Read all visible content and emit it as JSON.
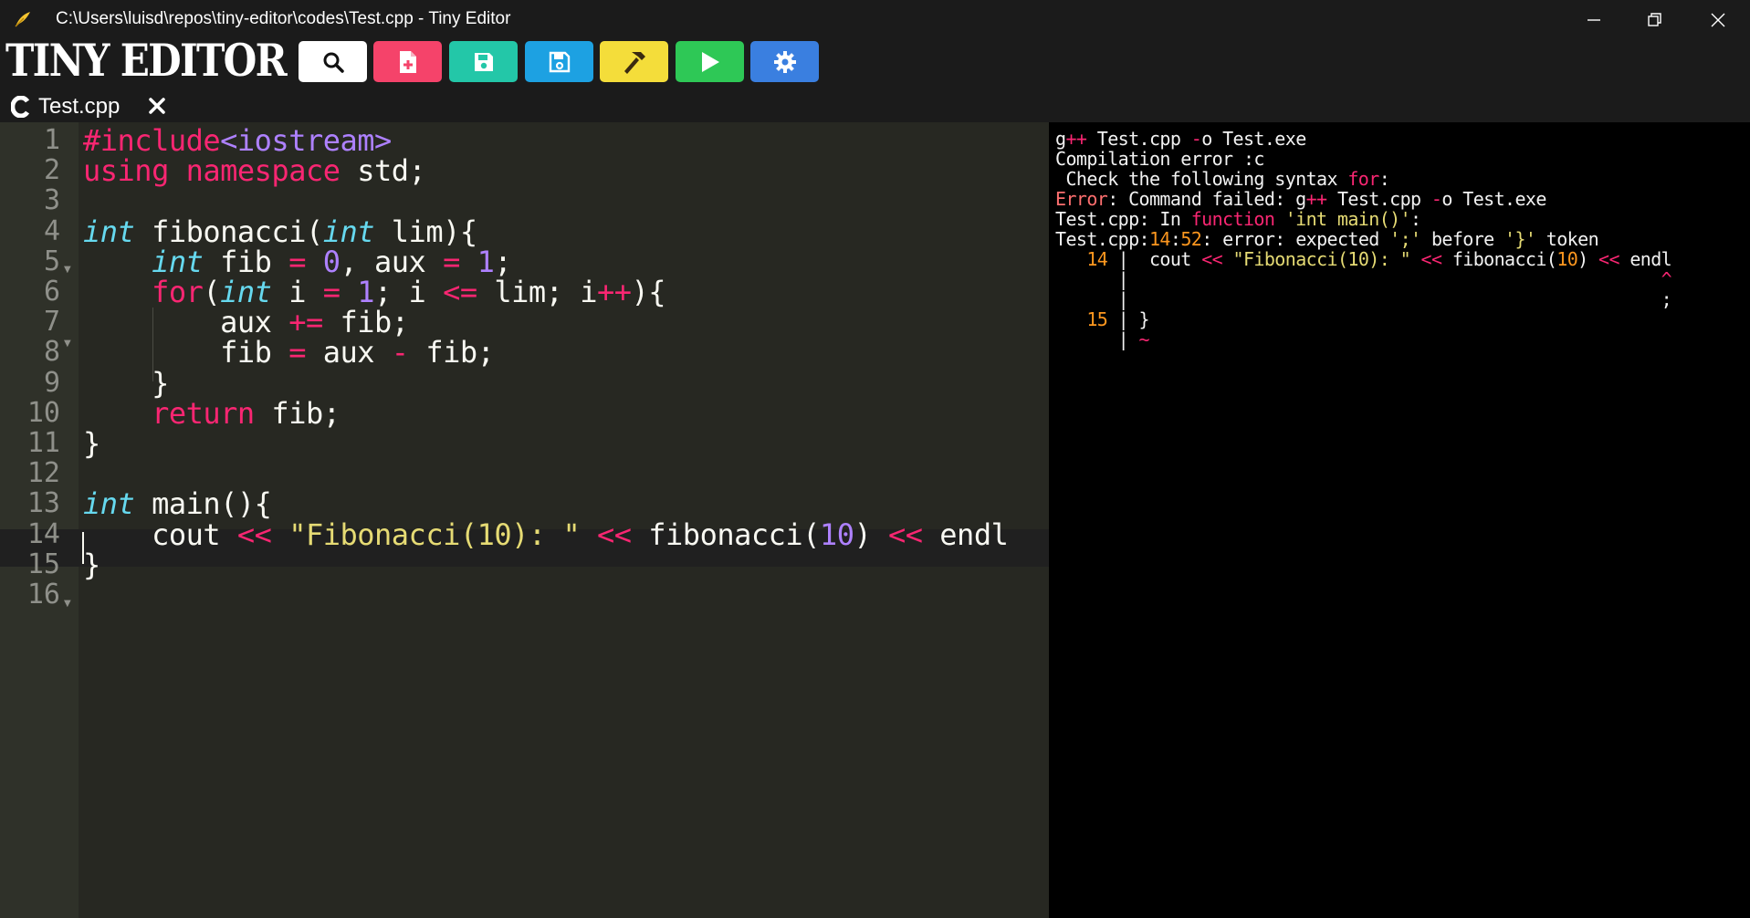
{
  "window": {
    "title": "C:\\Users\\luisd\\repos\\tiny-editor\\codes\\Test.cpp - Tiny Editor",
    "icon": "feather-icon"
  },
  "header": {
    "logo_text": "TINY EDITOR",
    "toolbar": [
      {
        "name": "search-button",
        "icon": "search-icon",
        "color": "#ffffff"
      },
      {
        "name": "new-file-button",
        "icon": "new-file-icon",
        "color": "#f5436a"
      },
      {
        "name": "save-button",
        "icon": "save-icon",
        "color": "#23c7a8"
      },
      {
        "name": "save-as-button",
        "icon": "save-as-icon",
        "color": "#1da1e2"
      },
      {
        "name": "build-button",
        "icon": "hammer-icon",
        "color": "#f4dd3a"
      },
      {
        "name": "run-button",
        "icon": "play-icon",
        "color": "#2ec856"
      },
      {
        "name": "settings-button",
        "icon": "gear-icon",
        "color": "#3a7fe0"
      }
    ]
  },
  "tab": {
    "icon": "c-language-icon",
    "label": "Test.cpp",
    "close_icon": "close-icon"
  },
  "editor": {
    "active_line": 12,
    "line_numbers": [
      "1",
      "2",
      "3",
      "4",
      "5",
      "6",
      "7",
      "8",
      "9",
      "10",
      "11",
      "12",
      "13",
      "14",
      "15",
      "16"
    ],
    "lines": [
      [
        {
          "t": "#include",
          "c": "kw"
        },
        {
          "t": "<iostream>",
          "c": "num"
        }
      ],
      [
        {
          "t": "using",
          "c": "kw"
        },
        {
          "t": " "
        },
        {
          "t": "namespace",
          "c": "kw"
        },
        {
          "t": " std;"
        }
      ],
      [],
      [
        {
          "t": "int",
          "c": "typ"
        },
        {
          "t": " fibonacci("
        },
        {
          "t": "int",
          "c": "typ"
        },
        {
          "t": " lim){"
        }
      ],
      [
        {
          "t": "    "
        },
        {
          "t": "int",
          "c": "typ"
        },
        {
          "t": " fib "
        },
        {
          "t": "=",
          "c": "op"
        },
        {
          "t": " "
        },
        {
          "t": "0",
          "c": "num"
        },
        {
          "t": ", aux "
        },
        {
          "t": "=",
          "c": "op"
        },
        {
          "t": " "
        },
        {
          "t": "1",
          "c": "num"
        },
        {
          "t": ";"
        }
      ],
      [
        {
          "t": "    "
        },
        {
          "t": "for",
          "c": "kw"
        },
        {
          "t": "("
        },
        {
          "t": "int",
          "c": "typ"
        },
        {
          "t": " i "
        },
        {
          "t": "=",
          "c": "op"
        },
        {
          "t": " "
        },
        {
          "t": "1",
          "c": "num"
        },
        {
          "t": "; i "
        },
        {
          "t": "<=",
          "c": "op"
        },
        {
          "t": " lim; i"
        },
        {
          "t": "++",
          "c": "op"
        },
        {
          "t": "){"
        }
      ],
      [
        {
          "t": "        aux "
        },
        {
          "t": "+=",
          "c": "op"
        },
        {
          "t": " fib;"
        }
      ],
      [
        {
          "t": "        fib "
        },
        {
          "t": "=",
          "c": "op"
        },
        {
          "t": " aux "
        },
        {
          "t": "-",
          "c": "op"
        },
        {
          "t": " fib;"
        }
      ],
      [
        {
          "t": "    }"
        }
      ],
      [
        {
          "t": "    "
        },
        {
          "t": "return",
          "c": "kw"
        },
        {
          "t": " fib;"
        }
      ],
      [
        {
          "t": "}"
        }
      ],
      [],
      [
        {
          "t": "int",
          "c": "typ"
        },
        {
          "t": " main(){"
        }
      ],
      [
        {
          "t": "    cout "
        },
        {
          "t": "<<",
          "c": "op"
        },
        {
          "t": " "
        },
        {
          "t": "\"Fibonacci(10): \"",
          "c": "str"
        },
        {
          "t": " "
        },
        {
          "t": "<<",
          "c": "op"
        },
        {
          "t": " fibonacci("
        },
        {
          "t": "10",
          "c": "num"
        },
        {
          "t": ") "
        },
        {
          "t": "<<",
          "c": "op"
        },
        {
          "t": " endl"
        }
      ],
      [
        {
          "t": "}"
        }
      ],
      []
    ]
  },
  "terminal": {
    "lines": [
      [
        {
          "t": "g"
        },
        {
          "t": "++",
          "c": "t-red"
        },
        {
          "t": " Test.cpp "
        },
        {
          "t": "-",
          "c": "t-red"
        },
        {
          "t": "o Test.exe"
        }
      ],
      [
        {
          "t": "Compilation error :c"
        }
      ],
      [
        {
          "t": " Check the following syntax "
        },
        {
          "t": "for",
          "c": "t-red"
        },
        {
          "t": ":"
        }
      ],
      [
        {
          "t": "Error",
          "c": "t-sal"
        },
        {
          "t": ": Command failed: g"
        },
        {
          "t": "++",
          "c": "t-red"
        },
        {
          "t": " Test.cpp "
        },
        {
          "t": "-",
          "c": "t-red"
        },
        {
          "t": "o Test.exe"
        }
      ],
      [
        {
          "t": "Test.cpp: In "
        },
        {
          "t": "function",
          "c": "t-red"
        },
        {
          "t": " "
        },
        {
          "t": "'int main()'",
          "c": "t-yel"
        },
        {
          "t": ":"
        }
      ],
      [
        {
          "t": "Test.cpp:"
        },
        {
          "t": "14",
          "c": "t-org"
        },
        {
          "t": ":"
        },
        {
          "t": "52",
          "c": "t-org"
        },
        {
          "t": ": error: expected "
        },
        {
          "t": "';'",
          "c": "t-yel"
        },
        {
          "t": " before "
        },
        {
          "t": "'}'",
          "c": "t-yel"
        },
        {
          "t": " token"
        }
      ],
      [
        {
          "t": "   "
        },
        {
          "t": "14",
          "c": "t-org"
        },
        {
          "t": " |  cout "
        },
        {
          "t": "<<",
          "c": "t-red"
        },
        {
          "t": " "
        },
        {
          "t": "\"Fibonacci(10): \"",
          "c": "t-yel"
        },
        {
          "t": " "
        },
        {
          "t": "<<",
          "c": "t-red"
        },
        {
          "t": " fibonacci("
        },
        {
          "t": "10",
          "c": "t-org"
        },
        {
          "t": ") "
        },
        {
          "t": "<<",
          "c": "t-red"
        },
        {
          "t": " endl"
        }
      ],
      [
        {
          "t": "      |                                                   "
        },
        {
          "t": "^",
          "c": "t-red"
        }
      ],
      [
        {
          "t": "      |                                                   ;"
        }
      ],
      [
        {
          "t": "   "
        },
        {
          "t": "15",
          "c": "t-org"
        },
        {
          "t": " | }"
        }
      ],
      [
        {
          "t": "      | "
        },
        {
          "t": "~",
          "c": "t-red"
        }
      ]
    ]
  }
}
